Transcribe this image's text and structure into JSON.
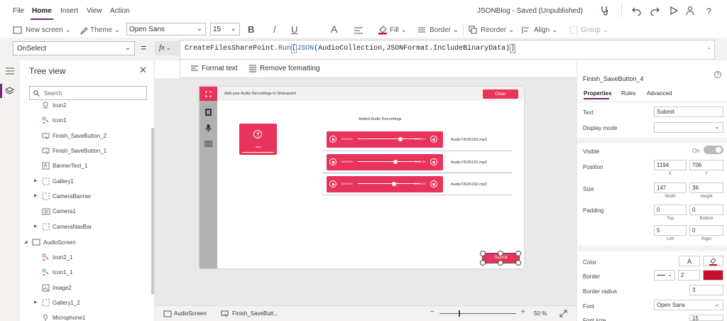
{
  "menu": {
    "items": [
      "File",
      "Home",
      "Insert",
      "View",
      "Action"
    ],
    "app_name": "JSONBlog - Saved (Unpublished)"
  },
  "toolbar": {
    "new_screen": "New screen",
    "theme": "Theme",
    "font": "Open Sans",
    "font_size": "15",
    "bold": "B",
    "italic": "/",
    "underline": "U",
    "font_color": "A",
    "fill": "Fill",
    "border": "Border",
    "reorder": "Reorder",
    "align": "Align",
    "group": "Group"
  },
  "formula": {
    "property": "OnSelect",
    "fx": "fx",
    "text_plain_1": "CreateFilesSharePoint.",
    "text_run": "Run",
    "text_paren_open": "(",
    "text_json": "JSON",
    "text_args": "(AudioCollection,JSONFormat.IncludeBinaryData)",
    "text_paren_close": ")",
    "format_text": "Format text",
    "remove_formatting": "Remove formatting"
  },
  "tree": {
    "title": "Tree view",
    "search_placeholder": "Search",
    "items": [
      "Icon2",
      "Icon1",
      "Finish_SaveButton_2",
      "Finish_SaveButton_1",
      "BannerText_1",
      "Gallery1",
      "CameraBanner",
      "Camera1",
      "CameraNavBar",
      "AudioScreen",
      "Icon2_1",
      "Icon1_1",
      "Image2",
      "Gallery1_2",
      "Microphone1"
    ]
  },
  "canvas": {
    "banner": "Add your Audio Recordings to Sharepoint",
    "clear": "Clear",
    "mic_label": "Start",
    "list_title": "Added Audio Recordings",
    "submit": "Submit",
    "rows": [
      {
        "t1": "00:00:00",
        "t2": "00:00:07",
        "file": "Audio7/6/20190.mp3",
        "pos": 0.68
      },
      {
        "t1": "00:00:00",
        "t2": "00:00:05",
        "file": "Audio7/6/20191.mp3",
        "pos": 0.6
      },
      {
        "t1": "00:00:00",
        "t2": "00:00:04",
        "file": "Audio7/6/20192.mp3",
        "pos": 0.58
      }
    ]
  },
  "bottom": {
    "screen_tab": "AudioScreen",
    "control_tab": "Finish_SaveButt...",
    "zoom": "50",
    "zoom_unit": "%",
    "minus": "−",
    "plus": "+"
  },
  "props": {
    "control": "Finish_SaveButton_4",
    "tabs": [
      "Properties",
      "Rules",
      "Advanced"
    ],
    "text_label": "Text",
    "text_value": "Submit",
    "display_mode": "Display mode",
    "visible": "Visible",
    "visible_value": "On",
    "position": "Position",
    "x": "1194",
    "y": "706",
    "x_lbl": "X",
    "y_lbl": "Y",
    "size": "Size",
    "width": "147",
    "height": "36",
    "width_lbl": "Width",
    "height_lbl": "Height",
    "padding": "Padding",
    "pad_top": "0",
    "pad_bottom": "0",
    "pad_left": "5",
    "pad_right": "0",
    "top_lbl": "Top",
    "bottom_lbl": "Bottom",
    "left_lbl": "Left",
    "right_lbl": "Right",
    "color": "Color",
    "color_a": "A",
    "border": "Border",
    "border_width": "2",
    "border_radius": "Border radius",
    "border_radius_value": "3",
    "font": "Font",
    "font_value": "Open Sans",
    "font_size": "Font size",
    "font_size_value": "15"
  },
  "colors": {
    "accent": "#742774",
    "pink": "#e8335a",
    "border_swatch": "#c8102e"
  }
}
